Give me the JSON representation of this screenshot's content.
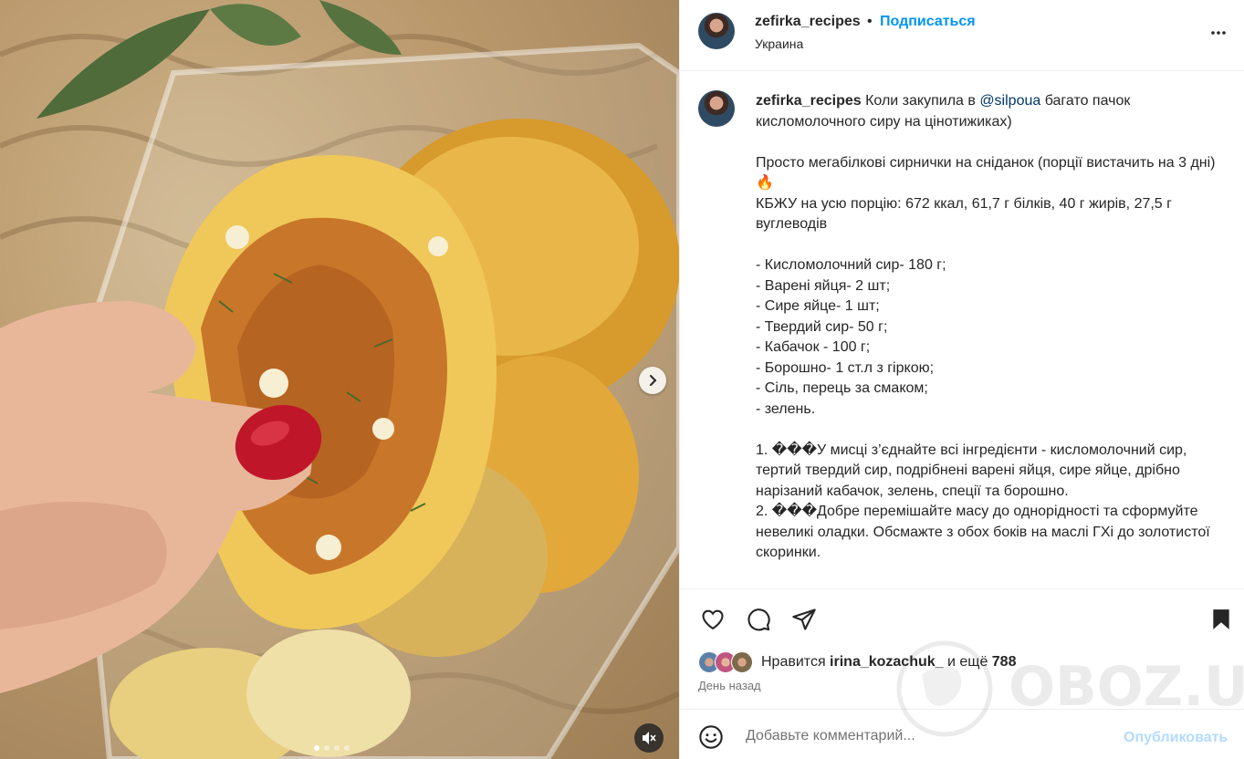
{
  "post": {
    "username": "zefirka_recipes",
    "separator": "•",
    "follow_label": "Подписаться",
    "location": "Украина"
  },
  "caption": {
    "username": "zefirka_recipes",
    "intro_before": " Коли закупила в ",
    "mention": "@silpoua",
    "intro_after": " багато пачок кисломолочного сиру на цінотижиках)",
    "body": "Просто мегабілкові сирнички на сніданок (порції вистачить на 3 дні) 🔥\nКБЖУ на усю порцію: 672 ккал, 61,7 г білків, 40 г жирів, 27,5 г вуглеводів\n\n- Кисломолочний сир- 180 г;\n- Варені яйця- 2 шт;\n- Сире яйце- 1 шт;\n- Твердий сир- 50 г;\n- Кабачок - 100 г;\n- Борошно- 1 ст.л з гіркою;\n- Сіль, перець за смаком;\n- зелень.\n\n1. ���У мисці з’єднайте всі інгредієнти - кисломолочний сир, тертий твердий сир, подрібнені варені яйця, сире яйце, дрібно нарізаний кабачок, зелень, спеції та борошно.\n2. ���Добре перемішайте масу до однорідності та сформуйте невеликі оладки. Обсмажте з обох боків на маслі ГХі до золотистої скоринки."
  },
  "likes": {
    "prefix": "Нравится ",
    "user": "irina_kozachuk_",
    "middle": " и ещё ",
    "count": "788"
  },
  "time_ago": "День назад",
  "comment": {
    "placeholder": "Добавьте комментарий...",
    "publish_label": "Опубликовать"
  },
  "carousel": {
    "total_slides": 4,
    "active_slide": 1
  },
  "watermark": "OBOZ.UA",
  "icons": {
    "more": "more-options-icon",
    "like": "heart-icon",
    "comment": "comment-icon",
    "share": "share-icon",
    "save": "bookmark-icon",
    "emoji": "emoji-icon",
    "mute": "muted-speaker-icon",
    "next": "chevron-right-icon"
  },
  "colors": {
    "accent": "#0095f6",
    "mention": "#00376b",
    "publish_disabled": "#b3dbff",
    "muted_text": "#737373"
  }
}
